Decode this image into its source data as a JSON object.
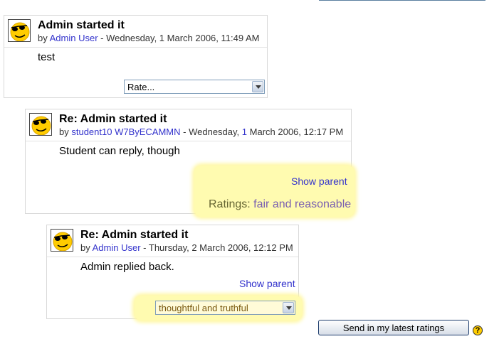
{
  "posts": [
    {
      "subject": "Admin started it",
      "by": "by",
      "author": "Admin User",
      "sep": " - ",
      "date": "Wednesday, 1 March 2006, 11:49 AM",
      "message": "test",
      "rate_select": "Rate..."
    },
    {
      "subject": "Re: Admin started it",
      "by": "by",
      "author": "student10 W7ByECAMMN",
      "sep": " - ",
      "date_prefix": "Wednesday,",
      "date_day": "1",
      "date_suffix": "March 2006, 12:17 PM",
      "message": "Student can reply, though",
      "show_parent": "Show parent",
      "ratings_label": "Ratings:",
      "ratings_value": "fair and reasonable"
    },
    {
      "subject": "Re: Admin started it",
      "by": "by",
      "author": "Admin User",
      "sep": " - ",
      "date": "Thursday, 2 March 2006, 12:12 PM",
      "message": "Admin replied back.",
      "show_parent": "Show parent",
      "rate_select": "thoughtful and truthful"
    }
  ],
  "send_button": "Send in my latest ratings",
  "help_icon": "?",
  "icons": {
    "avatar": "smiley-sunglasses-avatar",
    "help": "help-icon"
  }
}
